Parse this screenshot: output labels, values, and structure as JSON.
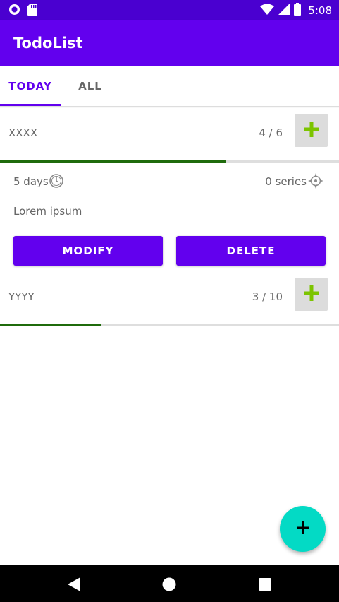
{
  "status_bar": {
    "time": "5:08",
    "icons": [
      "notification-circle-icon",
      "sd-card-icon",
      "wifi-icon",
      "signal-icon",
      "battery-icon"
    ]
  },
  "app_bar": {
    "title": "TodoList"
  },
  "tabs": [
    {
      "label": "TODAY",
      "selected": true
    },
    {
      "label": "ALL",
      "selected": false
    }
  ],
  "tasks": [
    {
      "name": "XXXX",
      "count": "4 / 6",
      "progress": 0.667,
      "expanded": true,
      "details": {
        "days": "5 days",
        "series": "0 series",
        "description": "Lorem ipsum",
        "modify_label": "MODIFY",
        "delete_label": "DELETE"
      }
    },
    {
      "name": "YYYY",
      "count": "3 / 10",
      "progress": 0.3,
      "expanded": false
    }
  ],
  "colors": {
    "primary": "#6200ee",
    "primary_dark": "#4a00d0",
    "accent": "#03dac5",
    "progress": "#1f6b0c",
    "add_icon": "#7cc400"
  }
}
